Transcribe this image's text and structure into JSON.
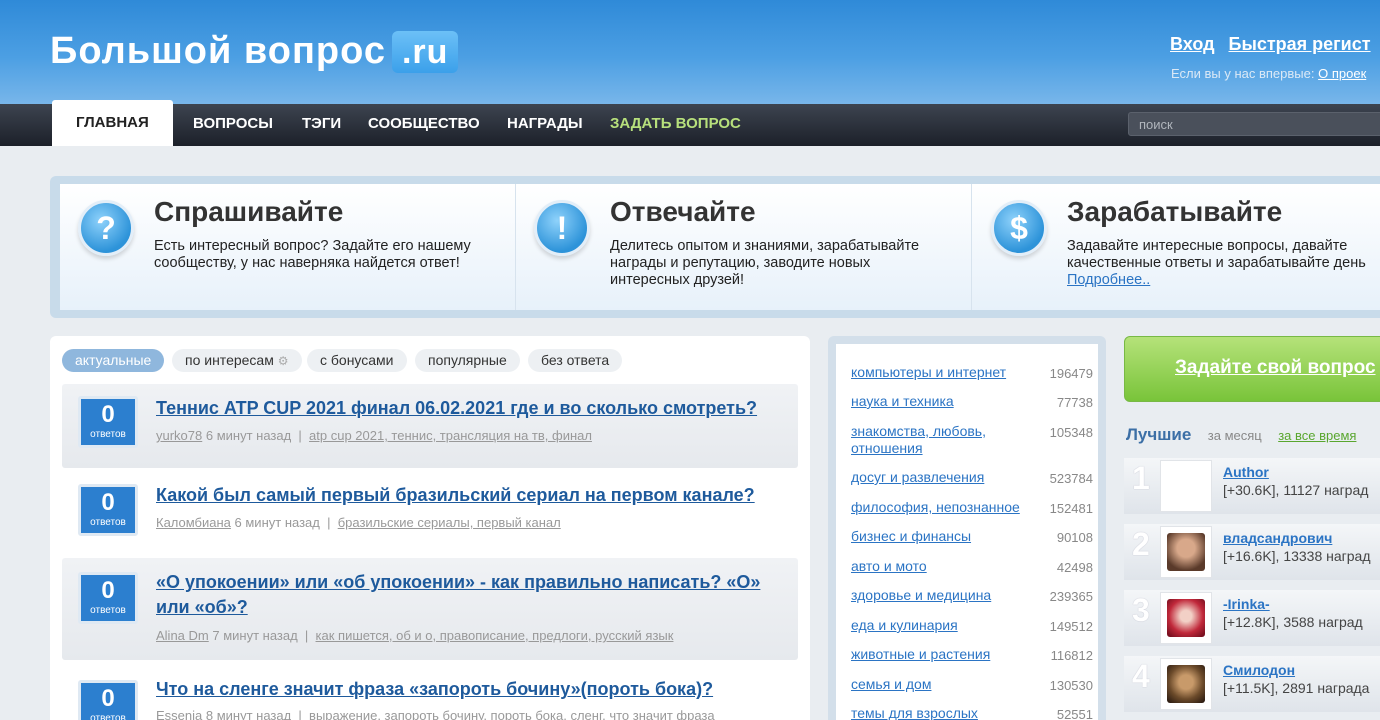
{
  "header": {
    "logo_text": "Большой вопрос",
    "logo_suffix": ".ru",
    "login": "Вход",
    "register": "Быстрая регист",
    "first_visit_text": "Если вы у нас впервые:",
    "first_visit_link": "О проек"
  },
  "nav": {
    "items": [
      "ГЛАВНАЯ",
      "ВОПРОСЫ",
      "ТЭГИ",
      "СООБЩЕСТВО",
      "НАГРАДЫ",
      "ЗАДАТЬ ВОПРОС"
    ],
    "search_placeholder": "поиск"
  },
  "promo": [
    {
      "icon": "?",
      "title": "Спрашивайте",
      "text": "Есть интересный вопрос? Задайте его нашему сообществу, у нас наверняка найдется ответ!"
    },
    {
      "icon": "!",
      "title": "Отвечайте",
      "text": "Делитесь опытом и знаниями, зарабатывайте награды и репутацию, заводите новых интересных друзей!"
    },
    {
      "icon": "$",
      "title": "Зарабатывайте",
      "text": "Задавайте интересные вопросы, давайте качественные ответы и зарабатывайте день",
      "link": "Подробнее.."
    }
  ],
  "filters": [
    "актуальные",
    "по интересам",
    "с бонусами",
    "популярные",
    "без ответа"
  ],
  "answers_label": "ответов",
  "questions": [
    {
      "count": "0",
      "title": "Теннис ATP CUP 2021 финал 06.02.2021 где и во сколько смотреть?",
      "author": "yurko78",
      "time": "6 минут назад",
      "tags": "atp cup 2021, теннис, трансляция на тв, финал"
    },
    {
      "count": "0",
      "title": "Какой был самый первый бразильский сериал на первом канале?",
      "author": "Каломбиана",
      "time": "6 минут назад",
      "tags": "бразильские сериалы, первый канал"
    },
    {
      "count": "0",
      "title": "«О упокоении» или «об упокоении» - как правильно написать? «О» или «об»?",
      "author": "Alina Dm",
      "time": "7 минут назад",
      "tags": "как пишется, об и о, правописание, предлоги, русский язык"
    },
    {
      "count": "0",
      "title": "Что на сленге значит фраза «запороть бочину»(пороть бока)?",
      "author": "Essenia",
      "time": "8 минут назад",
      "tags": "выражение, запороть бочину, пороть бока, сленг, что значит фраза"
    }
  ],
  "categories": [
    {
      "name": "компьютеры и интернет",
      "count": "196479"
    },
    {
      "name": "наука и техника",
      "count": "77738"
    },
    {
      "name": "знакомства, любовь, отношения",
      "count": "105348"
    },
    {
      "name": "досуг и развлечения",
      "count": "523784"
    },
    {
      "name": "философия, непознанное",
      "count": "152481"
    },
    {
      "name": "бизнес и финансы",
      "count": "90108"
    },
    {
      "name": "авто и мото",
      "count": "42498"
    },
    {
      "name": "здоровье и медицина",
      "count": "239365"
    },
    {
      "name": "еда и кулинария",
      "count": "149512"
    },
    {
      "name": "животные и растения",
      "count": "116812"
    },
    {
      "name": "семья и дом",
      "count": "130530"
    },
    {
      "name": "темы для взрослых",
      "count": "52551"
    }
  ],
  "ask_button": "Задайте свой вопрос",
  "best": {
    "title": "Лучшие",
    "period_month": "за месяц",
    "period_all": "за все время",
    "users": [
      {
        "rank": "1",
        "name": "Author",
        "stats": "[+30.6K], 11127 наград"
      },
      {
        "rank": "2",
        "name": "владсандрович",
        "stats": "[+16.6K], 13338 наград"
      },
      {
        "rank": "3",
        "name": "-Irinka-",
        "stats": "[+12.8K], 3588 наград"
      },
      {
        "rank": "4",
        "name": "Смилодон",
        "stats": "[+11.5K], 2891 награда"
      }
    ]
  }
}
